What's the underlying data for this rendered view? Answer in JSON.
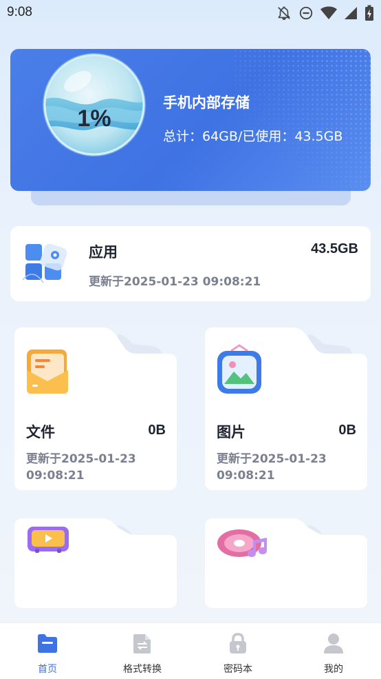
{
  "status_bar": {
    "time": "9:08",
    "icons": [
      "notifications-off-icon",
      "do-not-disturb-icon",
      "wifi-icon",
      "signal-icon",
      "battery-charging-icon"
    ]
  },
  "storage": {
    "percent_label": "1%",
    "percent_used": 0.01,
    "title": "手机内部存储",
    "detail": "总计：64GB/已使用：43.5GB",
    "accent_color": "#3f72e3"
  },
  "apps_card": {
    "label": "应用",
    "size": "43.5GB",
    "updated": "更新于2025-01-23 09:08:21",
    "icon": "apps-icon"
  },
  "folders": [
    {
      "label": "文件",
      "size": "0B",
      "updated": "更新于2025-01-23 09:08:21",
      "icon": "document-folder-icon"
    },
    {
      "label": "图片",
      "size": "0B",
      "updated": "更新于2025-01-23 09:08:21",
      "icon": "picture-icon"
    },
    {
      "label": "",
      "size": "",
      "updated": "",
      "icon": "video-icon"
    },
    {
      "label": "",
      "size": "",
      "updated": "",
      "icon": "music-disc-icon"
    }
  ],
  "bottom_nav": [
    {
      "label": "首页",
      "icon": "home-folder-icon",
      "active": true
    },
    {
      "label": "格式转换",
      "icon": "format-convert-icon",
      "active": false
    },
    {
      "label": "密码本",
      "icon": "lock-icon",
      "active": false
    },
    {
      "label": "我的",
      "icon": "profile-icon",
      "active": false
    }
  ],
  "colors": {
    "active_nav": "#3f72e3",
    "inactive_icon": "#c4c7cd",
    "muted_text": "#7b8090"
  }
}
